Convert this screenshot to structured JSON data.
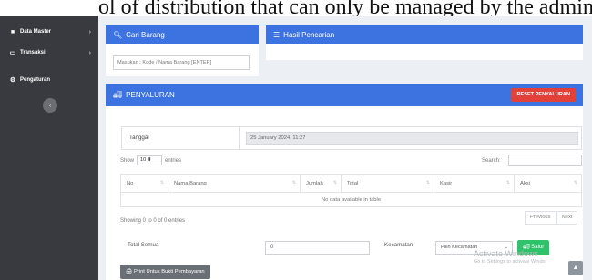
{
  "caption": {
    "text": "ol of distribution that can only be managed by the admin."
  },
  "sidebar": {
    "items": [
      {
        "label": "Data Master",
        "icon": "database-icon"
      },
      {
        "label": "Transaksi",
        "icon": "monitor-icon"
      },
      {
        "label": "Pengaturan",
        "icon": "gears-icon"
      }
    ],
    "collapse_glyph": "‹"
  },
  "cari_barang": {
    "title": "Cari Barang",
    "placeholder": "Masukan : Kode / Nama Barang  [ENTER]"
  },
  "hasil_pencarian": {
    "title": "Hasil Pencarian"
  },
  "penyaluran": {
    "title": "PENYALURAN",
    "reset_label": "RESET PENYALURAN",
    "tanggal_label": "Tanggal",
    "tanggal_value": "25 January 2024, 11:27",
    "show_label": "Show",
    "entries_value": "10",
    "entries_label": "entries",
    "search_label": "Search:",
    "columns": [
      "No",
      "Nama Barang",
      "Jumlah",
      "Total",
      "Kasir",
      "Aksi"
    ],
    "empty_message": "No data available in table",
    "info": "Showing 0 to 0 of 0 entries",
    "previous_label": "Previous",
    "next_label": "Next",
    "total_label": "Total Semua",
    "total_value": "0",
    "kecamatan_label": "Kecamatan",
    "kecamatan_selected": "Pilih Kecamatan",
    "salur_label": "Salur",
    "print_label": "Print Untuk Bukti Pembayaran"
  },
  "watermark": {
    "line1": "Activate Windows",
    "line2": "Go to Settings to activate Windo"
  },
  "colors": {
    "sidebar": "#383a3f",
    "header_blue": "#3c73e0",
    "reset_red": "#e2413a",
    "salur_green": "#2ec26a",
    "print_gray": "#6a6f76"
  }
}
